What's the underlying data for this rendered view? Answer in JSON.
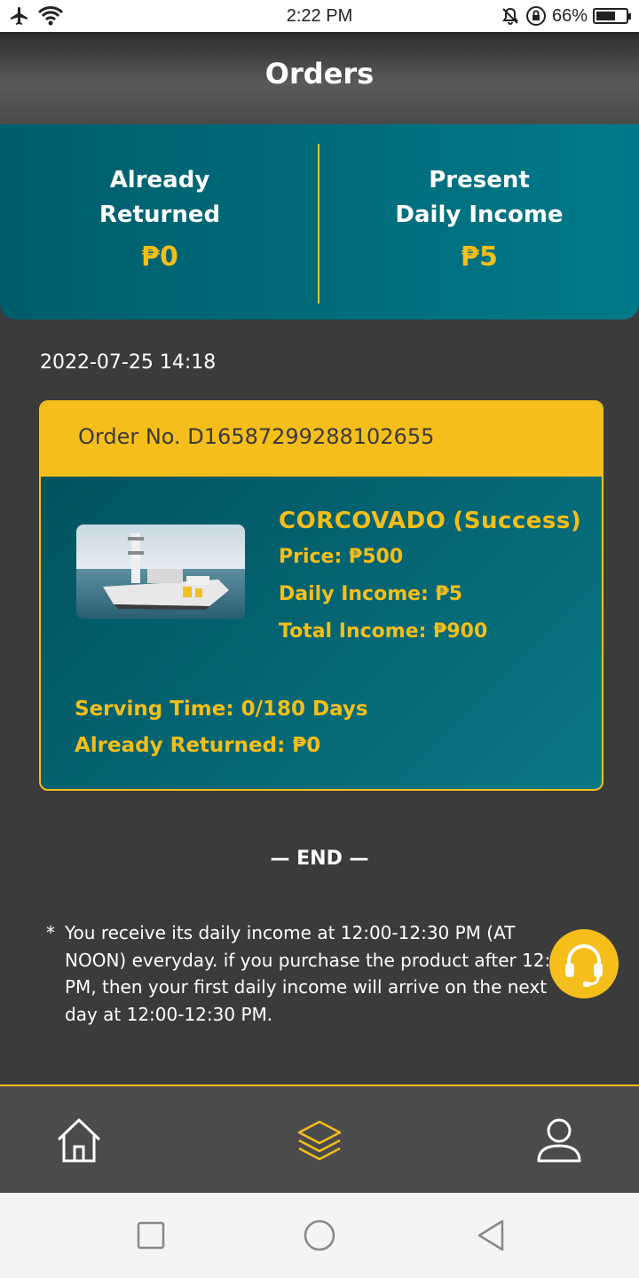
{
  "status_bar": {
    "time": "2:22 PM",
    "battery": "66%",
    "battery_level": 0.66
  },
  "header": {
    "title": "Orders"
  },
  "summary": {
    "already_returned_label_1": "Already",
    "already_returned_label_2": "Returned",
    "already_returned_value": "₱0",
    "present_income_label_1": "Present",
    "present_income_label_2": "Daily Income",
    "present_income_value": "₱5"
  },
  "orders": [
    {
      "date": "2022-07-25 14:18",
      "order_no": "Order No. D16587299288102655",
      "product_name": "CORCOVADO",
      "status": "(Success)",
      "price": "Price: ₱500",
      "daily_income": "Daily Income: ₱5",
      "total_income": "Total Income: ₱900",
      "serving_time": "Serving Time: 0/180 Days",
      "already_returned": "Already Returned: ₱0"
    }
  ],
  "end_text": "— END —",
  "note": {
    "star": "*",
    "text": "You receive its daily income at 12:00-12:30 PM (AT NOON) everyday. if you purchase the product after 12:00 PM, then your first daily income will arrive on the next day at 12:00-12:30 PM."
  },
  "icons": {
    "airplane": "airplane-icon",
    "wifi": "wifi-icon",
    "silent": "bell-off-icon",
    "rotation_lock": "rotation-lock-icon",
    "support": "headset-icon",
    "home": "home-icon",
    "orders": "layers-icon",
    "profile": "user-icon"
  },
  "colors": {
    "accent": "#f5be1a",
    "teal": "#007a8a",
    "background": "#3b3b3b"
  }
}
